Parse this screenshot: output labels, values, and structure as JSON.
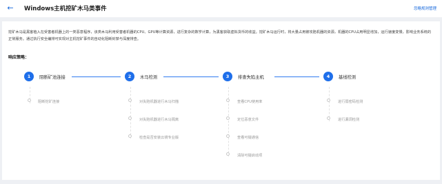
{
  "header": {
    "back_icon": "arrow-left-icon",
    "title": "Windows主机挖矿木马类事件",
    "manage_link": "忽略规则管理"
  },
  "colors": {
    "accent": "#1f6fea",
    "background": "#eef0f4"
  },
  "description": "挖矿木马是黑客植入在受害者机器上的一类恶意程序，该类木马利用受害者机器的CPU、GPU等计算资源，进行复杂的数学计算，为黑客获取虚拟货币的收益。挖矿木马运行时，将大量占用被攻陷机器的资源，机器的CPU占用明显增加，运行速度变慢，影响业务系统的正常服务。通过执行安全编排可实现对主机挖矿事件的自动化阻断封禁与深度排查。",
  "strategy_label": "响应策略：",
  "steps": [
    {
      "number": "1",
      "label": "阻断矿池连接",
      "actions": [
        "阻断挖矿连接"
      ]
    },
    {
      "number": "2",
      "label": "木马检测",
      "actions": [
        "对失陷机器进行木马扫描",
        "对失陷机器进行木马隔离",
        "检查是否安装云镜专业版"
      ]
    },
    {
      "number": "3",
      "label": "排查失陷主机",
      "actions": [
        "查看CPU使用率",
        "定位恶意文件",
        "查看可疑通信",
        "清除可疑启动项"
      ]
    },
    {
      "number": "4",
      "label": "基线检测",
      "actions": [
        "进行弱密码检测",
        "进行漏洞检测"
      ]
    }
  ]
}
